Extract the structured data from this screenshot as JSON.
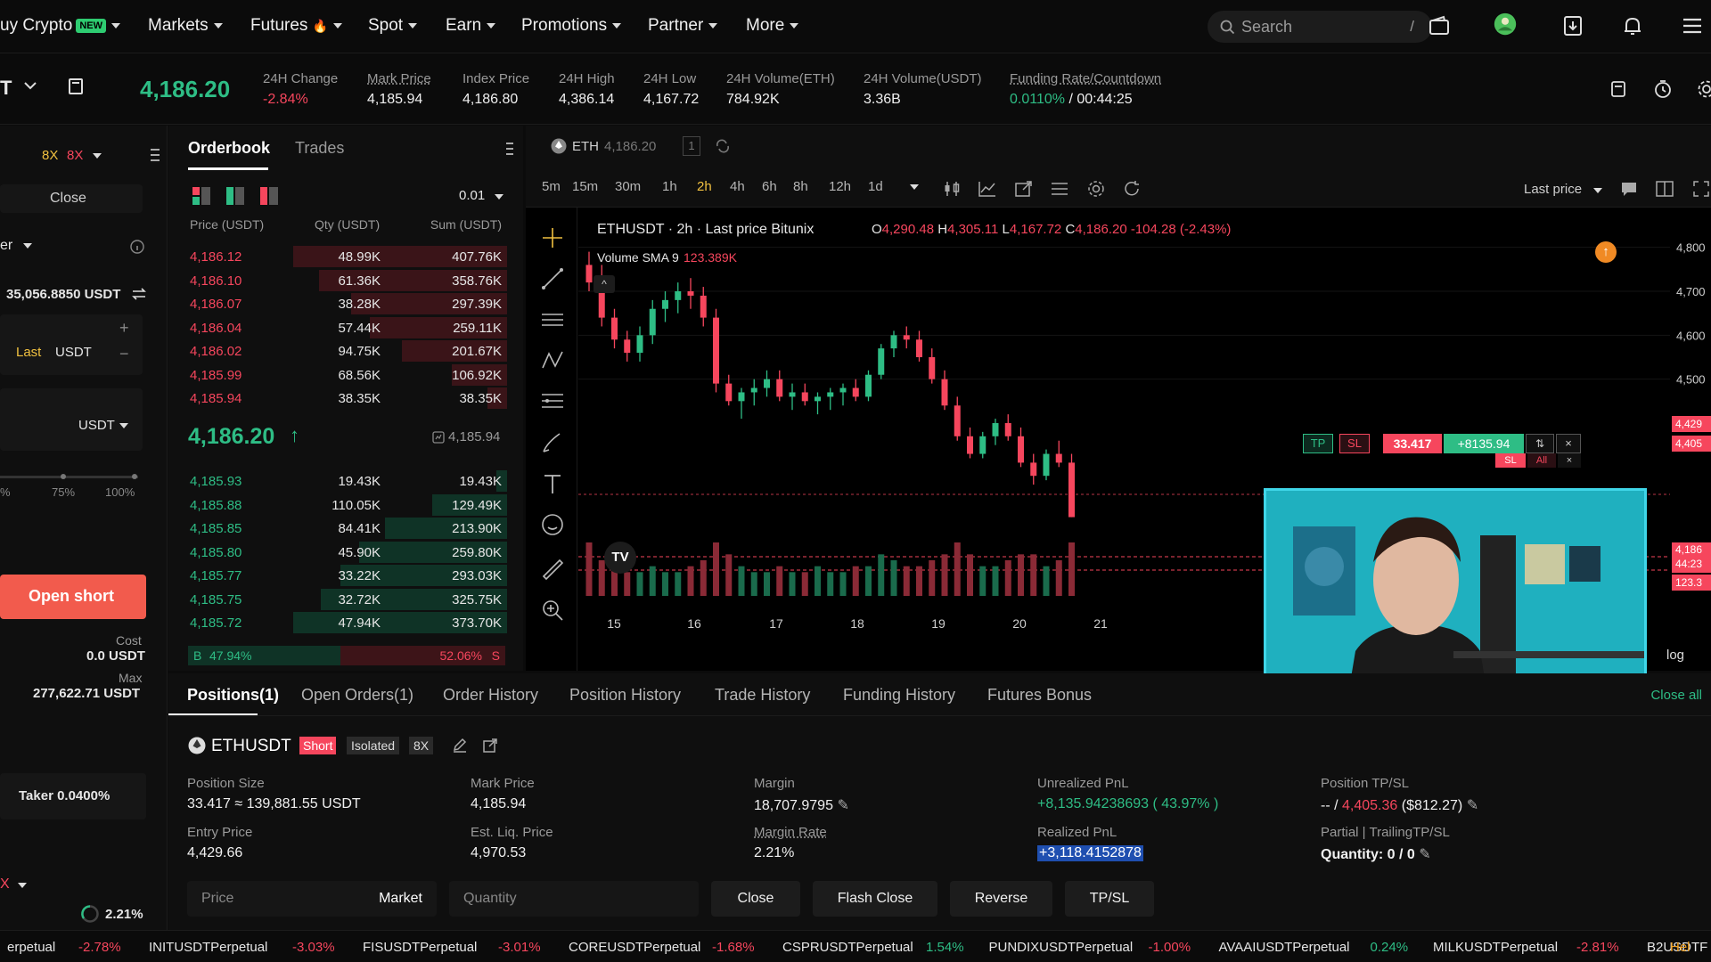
{
  "nav": {
    "items": [
      "uy Crypto",
      "Markets",
      "Futures",
      "Spot",
      "Earn",
      "Promotions",
      "Partner",
      "More"
    ],
    "new_badge": "NEW",
    "futures_emoji": "🔥",
    "search_placeholder": "Search",
    "search_shortcut": "/"
  },
  "ticker": {
    "symbol_partial": "T",
    "last_price": "4,186.20",
    "stats": [
      {
        "label": "24H Change",
        "value": "-2.84%"
      },
      {
        "label": "Mark Price",
        "value": "4,185.94"
      },
      {
        "label": "Index Price",
        "value": "4,186.80"
      },
      {
        "label": "24H High",
        "value": "4,386.14"
      },
      {
        "label": "24H Low",
        "value": "4,167.72"
      },
      {
        "label": "24H Volume(ETH)",
        "value": "784.92K"
      },
      {
        "label": "24H Volume(USDT)",
        "value": "3.36B"
      }
    ],
    "funding_label": "Funding Rate/Countdown",
    "funding_rate": "0.0110%",
    "funding_sep": "/",
    "countdown": "00:44:25"
  },
  "left": {
    "leverage_a": "8X",
    "leverage_b": "8X",
    "close_label": "Close",
    "order_type": "er",
    "available": "35,056.8850 USDT",
    "last_label": "Last",
    "unit": "USDT",
    "unit_select": "USDT",
    "pct_labels": [
      "%",
      "75%",
      "100%"
    ],
    "open_short": "Open short",
    "cost_label": "Cost",
    "cost_value": "0.0 USDT",
    "max_label": "Max",
    "max_value": "277,622.71 USDT",
    "taker": "Taker 0.0400%",
    "bottom_x": "X",
    "margin_ratio": "2.21%"
  },
  "orderbook": {
    "tabs": [
      "Orderbook",
      "Trades"
    ],
    "precision": "0.01",
    "headers": [
      "Price (USDT)",
      "Qty (USDT)",
      "Sum (USDT)"
    ],
    "asks": [
      {
        "price": "4,186.12",
        "qty": "48.99K",
        "sum": "407.76K",
        "depth": 1.0
      },
      {
        "price": "4,186.10",
        "qty": "61.36K",
        "sum": "358.76K",
        "depth": 0.88
      },
      {
        "price": "4,186.07",
        "qty": "38.28K",
        "sum": "297.39K",
        "depth": 0.73
      },
      {
        "price": "4,186.04",
        "qty": "57.44K",
        "sum": "259.11K",
        "depth": 0.64
      },
      {
        "price": "4,186.02",
        "qty": "94.75K",
        "sum": "201.67K",
        "depth": 0.49
      },
      {
        "price": "4,185.99",
        "qty": "68.56K",
        "sum": "106.92K",
        "depth": 0.26
      },
      {
        "price": "4,185.94",
        "qty": "38.35K",
        "sum": "38.35K",
        "depth": 0.09
      }
    ],
    "mid_price": "4,186.20",
    "mid_arrow": "↑",
    "mid_mark": "4,185.94",
    "bids": [
      {
        "price": "4,185.93",
        "qty": "19.43K",
        "sum": "19.43K",
        "depth": 0.05
      },
      {
        "price": "4,185.88",
        "qty": "110.05K",
        "sum": "129.49K",
        "depth": 0.35
      },
      {
        "price": "4,185.85",
        "qty": "84.41K",
        "sum": "213.90K",
        "depth": 0.57
      },
      {
        "price": "4,185.80",
        "qty": "45.90K",
        "sum": "259.80K",
        "depth": 0.69
      },
      {
        "price": "4,185.77",
        "qty": "33.22K",
        "sum": "293.03K",
        "depth": 0.78
      },
      {
        "price": "4,185.75",
        "qty": "32.72K",
        "sum": "325.75K",
        "depth": 0.87
      },
      {
        "price": "4,185.72",
        "qty": "47.94K",
        "sum": "373.70K",
        "depth": 1.0
      }
    ],
    "buy_label": "B",
    "buy_pct": "47.94%",
    "sell_pct": "52.06%",
    "sell_label": "S",
    "buy_ratio": 0.4794
  },
  "chart": {
    "header_symbol": "ETH",
    "header_price": "4,186.20",
    "header_count": "1",
    "timeframes": [
      "5m",
      "15m",
      "30m",
      "1h",
      "2h",
      "4h",
      "6h",
      "8h",
      "12h",
      "1d"
    ],
    "active_tf": "2h",
    "price_type": "Last price",
    "legend_title": "ETHUSDT · 2h · Last price Bitunix",
    "ohlc": {
      "o_label": "O",
      "o": "4,290.48",
      "h_label": "H",
      "h": "4,305.11",
      "l_label": "L",
      "l": "4,167.72",
      "c_label": "C",
      "c": "4,186.20",
      "chg": "-104.28 (-2.43%)"
    },
    "volume_label": "Volume SMA 9",
    "volume_value": "123.389K",
    "x_ticks": [
      "15",
      "16",
      "17",
      "18",
      "19",
      "20",
      "21"
    ],
    "y_ticks": [
      "4,800",
      "4,700",
      "4,600",
      "4,500"
    ],
    "right_labels": [
      "4,429",
      "4,405",
      "4,186",
      "44:23",
      "123.3"
    ],
    "position_line": {
      "tp": "TP",
      "sl": "SL",
      "qty": "33.417",
      "pnl": "+8135.94",
      "sl2": "SL",
      "all": "All"
    },
    "log_label": "log",
    "tv_logo": "TV",
    "colors": {
      "up": "#2ebd85",
      "down": "#f6465d"
    },
    "chart_data": {
      "type": "candlestick",
      "x_ticks": [
        "15",
        "16",
        "17",
        "18",
        "19",
        "20",
        "21"
      ],
      "ylim": [
        4100,
        4850
      ],
      "candles": [
        [
          4760,
          4790,
          4700,
          4720
        ],
        [
          4720,
          4760,
          4620,
          4640
        ],
        [
          4640,
          4660,
          4570,
          4590
        ],
        [
          4590,
          4610,
          4540,
          4560
        ],
        [
          4560,
          4620,
          4540,
          4600
        ],
        [
          4600,
          4680,
          4580,
          4660
        ],
        [
          4660,
          4700,
          4630,
          4680
        ],
        [
          4680,
          4720,
          4650,
          4700
        ],
        [
          4700,
          4730,
          4660,
          4690
        ],
        [
          4690,
          4710,
          4620,
          4640
        ],
        [
          4640,
          4660,
          4470,
          4490
        ],
        [
          4490,
          4510,
          4440,
          4450
        ],
        [
          4450,
          4480,
          4410,
          4470
        ],
        [
          4470,
          4500,
          4440,
          4480
        ],
        [
          4480,
          4520,
          4460,
          4500
        ],
        [
          4500,
          4520,
          4450,
          4460
        ],
        [
          4460,
          4490,
          4430,
          4470
        ],
        [
          4470,
          4490,
          4440,
          4450
        ],
        [
          4450,
          4470,
          4420,
          4460
        ],
        [
          4460,
          4480,
          4430,
          4470
        ],
        [
          4470,
          4490,
          4440,
          4480
        ],
        [
          4480,
          4500,
          4450,
          4460
        ],
        [
          4460,
          4520,
          4450,
          4510
        ],
        [
          4510,
          4580,
          4500,
          4570
        ],
        [
          4570,
          4610,
          4550,
          4600
        ],
        [
          4600,
          4620,
          4570,
          4590
        ],
        [
          4590,
          4610,
          4540,
          4550
        ],
        [
          4550,
          4570,
          4490,
          4500
        ],
        [
          4500,
          4520,
          4430,
          4440
        ],
        [
          4440,
          4460,
          4360,
          4370
        ],
        [
          4370,
          4390,
          4320,
          4330
        ],
        [
          4330,
          4380,
          4320,
          4370
        ],
        [
          4370,
          4410,
          4350,
          4400
        ],
        [
          4400,
          4420,
          4360,
          4370
        ],
        [
          4370,
          4390,
          4300,
          4310
        ],
        [
          4310,
          4330,
          4260,
          4280
        ],
        [
          4280,
          4340,
          4270,
          4330
        ],
        [
          4330,
          4360,
          4300,
          4310
        ],
        [
          4310,
          4330,
          4186,
          4186
        ]
      ],
      "volumes": [
        9,
        6,
        5,
        4,
        4,
        5,
        4,
        4,
        5,
        6,
        9,
        7,
        5,
        4,
        4,
        5,
        4,
        4,
        5,
        4,
        4,
        5,
        5,
        7,
        6,
        5,
        5,
        6,
        7,
        9,
        7,
        5,
        5,
        6,
        7,
        7,
        5,
        6,
        9
      ]
    }
  },
  "bottom": {
    "tabs": [
      "Positions(1)",
      "Open Orders(1)",
      "Order History",
      "Position History",
      "Trade History",
      "Funding History",
      "Futures Bonus"
    ],
    "close_all": "Close all",
    "pos_symbol": "ETHUSDT",
    "pos_side": "Short",
    "pos_mode": "Isolated",
    "pos_lev": "8X",
    "fields": {
      "size_label": "Position Size",
      "size_value": "33.417 ≈ 139,881.55 USDT",
      "mark_label": "Mark Price",
      "mark_value": "4,185.94",
      "margin_label": "Margin",
      "margin_value": "18,707.9795",
      "upnl_label": "Unrealized PnL",
      "upnl_value": "+8,135.94238693 ( 43.97% )",
      "tpsl_label": "Position TP/SL",
      "tpsl_prefix": "-- /",
      "tpsl_price": "4,405.36",
      "tpsl_amount": "($812.27)",
      "entry_label": "Entry Price",
      "entry_value": "4,429.66",
      "liq_label": "Est. Liq. Price",
      "liq_value": "4,970.53",
      "mrate_label": "Margin Rate",
      "mrate_value": "2.21%",
      "rpnl_label": "Realized PnL",
      "rpnl_value": "+3,118.4152878",
      "partial_label": "Partial | TrailingTP/SL",
      "partial_value": "Quantity: 0 / 0"
    },
    "price_placeholder": "Price",
    "market_label": "Market",
    "qty_placeholder": "Quantity",
    "btn_close": "Close",
    "btn_flash": "Flash Close",
    "btn_reverse": "Reverse",
    "btn_tpsl": "TP/SL"
  },
  "marquee": [
    {
      "sym": "erpetual",
      "chg": "-2.78%",
      "up": false
    },
    {
      "sym": "INITUSDTPerpetual",
      "chg": "-3.03%",
      "up": false
    },
    {
      "sym": "FISUSDTPerpetual",
      "chg": "-3.01%",
      "up": false
    },
    {
      "sym": "COREUSDTPerpetual",
      "chg": "-1.68%",
      "up": false
    },
    {
      "sym": "CSPRUSDTPerpetual",
      "chg": "1.54%",
      "up": true
    },
    {
      "sym": "PUNDIXUSDTPerpetual",
      "chg": "-1.00%",
      "up": false
    },
    {
      "sym": "AVAAIUSDTPerpetual",
      "chg": "0.24%",
      "up": true
    },
    {
      "sym": "MILKUSDTPerpetual",
      "chg": "-2.81%",
      "up": false
    },
    {
      "sym": "B2USDTF",
      "chg": "",
      "up": true
    }
  ],
  "help_label": "Hel"
}
